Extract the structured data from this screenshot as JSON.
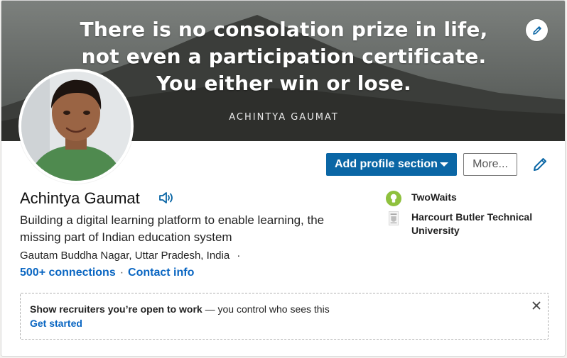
{
  "banner": {
    "quote_lines": [
      "There is no consolation prize in life,",
      "not even a participation certificate.",
      "You either win or lose."
    ],
    "quote_author": "ACHINTYA GAUMAT",
    "edit_icon": "pencil-icon"
  },
  "actions": {
    "add_section_label": "Add profile section",
    "more_label": "More...",
    "edit_icon": "pencil-icon"
  },
  "profile": {
    "name": "Achintya Gaumat",
    "pronunciation_icon": "speaker-icon",
    "headline": "Building a digital learning platform to enable learning, the missing part of Indian education system",
    "location": "Gautam Buddha Nagar, Uttar Pradesh, India",
    "location_separator": "·",
    "connections": "500+ connections",
    "link_separator": "·",
    "contact_info": "Contact info"
  },
  "organizations": [
    {
      "name": "TwoWaits",
      "icon": "lightbulb-logo"
    },
    {
      "name": "Harcourt Butler Technical University",
      "icon": "university-crest-logo"
    }
  ],
  "open_to_work": {
    "title": "Show recruiters you’re open to work",
    "dash": " — ",
    "subtitle": "you control who sees this",
    "cta": "Get started",
    "close_icon": "close-icon"
  },
  "colors": {
    "primary_blue": "#0a66a5",
    "link_blue": "#0a66c2",
    "logo_green": "#8fc13e"
  }
}
